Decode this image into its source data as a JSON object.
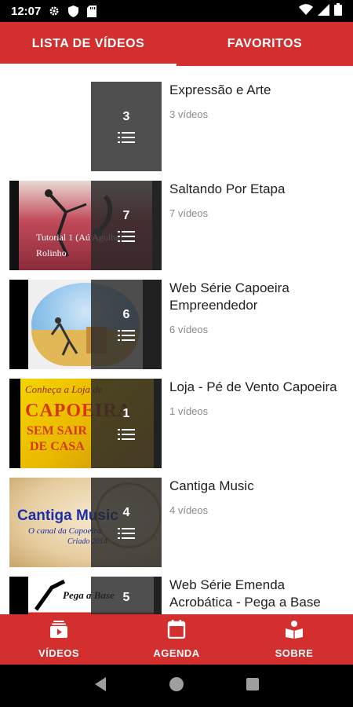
{
  "status": {
    "time": "12:07"
  },
  "tabs": [
    {
      "label": "LISTA DE VÍDEOS",
      "active": true
    },
    {
      "label": "FAVORITOS",
      "active": false
    }
  ],
  "playlists": [
    {
      "title": "Expressão e Arte",
      "count_label": "3 vídeos",
      "count": "3"
    },
    {
      "title": "Saltando Por Etapa",
      "count_label": "7 vídeos",
      "count": "7"
    },
    {
      "title": "Web Série Capoeira Empreendedor",
      "count_label": "6 vídeos",
      "count": "6"
    },
    {
      "title": "Loja - Pé de Vento Capoeira",
      "count_label": "1 vídeos",
      "count": "1"
    },
    {
      "title": "Cantiga Music",
      "count_label": "4 vídeos",
      "count": "4"
    },
    {
      "title": "Web Série Emenda Acrobática - Pega a Base",
      "count_label": "",
      "count": "5"
    }
  ],
  "thumb_texts": {
    "saltando": "Tutorial 1 (Aú Agulha) Rolinho",
    "loja": [
      "Conheça a Loja de",
      "CAPOEIRA",
      "SEM SAIR",
      "DE CASA"
    ],
    "cantiga": [
      "Cantiga Music",
      "O canal da Capoeira",
      "Criado 2014"
    ],
    "pega": "Pega a Base"
  },
  "bottom_nav": [
    {
      "label": "VÍDEOS",
      "icon": "video-library-icon"
    },
    {
      "label": "AGENDA",
      "icon": "calendar-icon"
    },
    {
      "label": "SOBRE",
      "icon": "book-icon"
    }
  ],
  "colors": {
    "primary": "#d32f2f",
    "overlay": "#2b2b2b",
    "text": "#212121",
    "subtext": "#8a8a8a"
  }
}
